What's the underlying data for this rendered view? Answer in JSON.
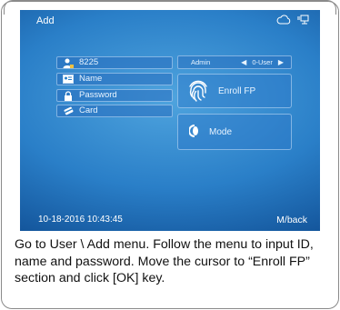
{
  "screen": {
    "title": "Add",
    "status_datetime": "10-18-2016 10:43:45",
    "back_label": "M/back"
  },
  "form": {
    "user_id": "8225",
    "name_placeholder": "Name",
    "password_placeholder": "Password",
    "card_label": "Card"
  },
  "role": {
    "label": "Admin",
    "value": "0-User"
  },
  "actions": {
    "enroll_fp": "Enroll FP",
    "mode": "Mode"
  },
  "caption": "Go to User \\ Add menu. Follow the menu to input ID, name and password. Move the cursor to “Enroll FP” section and click [OK] key.",
  "colors": {
    "screen_top": "#4fa4de",
    "screen_bottom": "#0c3f7a",
    "text": "#ffffff"
  }
}
